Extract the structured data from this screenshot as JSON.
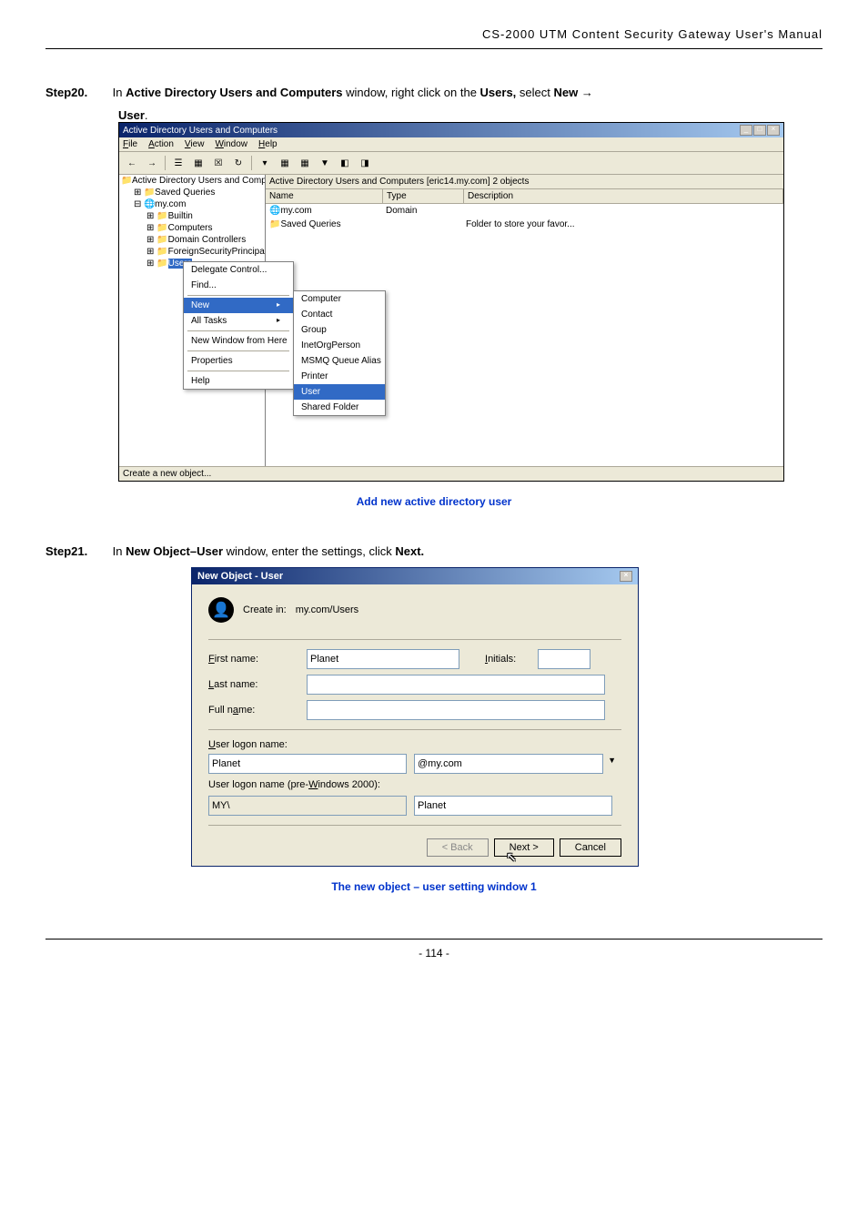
{
  "header": "CS-2000 UTM Content Security Gateway User's Manual",
  "step20": {
    "label": "Step20.",
    "text_parts": [
      "In ",
      "Active Directory Users and Computers",
      " window, right click on the ",
      "Users,",
      " select ",
      "New",
      " →"
    ],
    "text2": "User",
    "text2_suffix": "."
  },
  "aduc": {
    "title": "Active Directory Users and Computers",
    "menu": [
      "File",
      "Action",
      "View",
      "Window",
      "Help"
    ],
    "menu_underline": [
      "F",
      "A",
      "V",
      "W",
      "H"
    ],
    "tree": {
      "root": "Active Directory Users and Comput",
      "nodes": [
        {
          "label": "Saved Queries"
        },
        {
          "label": "my.com",
          "children": [
            {
              "label": "Builtin"
            },
            {
              "label": "Computers"
            },
            {
              "label": "Domain Controllers"
            },
            {
              "label": "ForeignSecurityPrincipals"
            },
            {
              "label": "Users",
              "selected": true
            }
          ]
        }
      ]
    },
    "list": {
      "header_title": "Active Directory Users and Computers [eric14.my.com]   2 objects",
      "columns": [
        "Name",
        "Type",
        "Description"
      ],
      "rows": [
        {
          "name": "my.com",
          "type": "Domain",
          "desc": ""
        },
        {
          "name": "Saved Queries",
          "type": "",
          "desc": "Folder to store your favor..."
        }
      ]
    },
    "context1": [
      "Delegate Control...",
      "Find...",
      "—",
      "New",
      "All Tasks",
      "—",
      "New Window from Here",
      "—",
      "Properties",
      "—",
      "Help"
    ],
    "context1_highlight": "New",
    "context2": [
      "Computer",
      "Contact",
      "Group",
      "InetOrgPerson",
      "MSMQ Queue Alias",
      "Printer",
      "User",
      "Shared Folder"
    ],
    "context2_highlight": "User",
    "status": "Create a new object..."
  },
  "caption1": "Add new active directory user",
  "step21": {
    "label": "Step21.",
    "text_parts": [
      "In ",
      "New Object–User",
      " window, enter the settings, click ",
      "Next."
    ]
  },
  "dialog": {
    "title": "New Object - User",
    "createin_label": "Create in:",
    "createin_value": "my.com/Users",
    "labels": {
      "first": "First name:",
      "last": "Last name:",
      "full": "Full name:",
      "initials": "Initials:",
      "logon": "User logon name:",
      "logon2000": "User logon name (pre-Windows 2000):"
    },
    "values": {
      "first": "Planet",
      "last": "",
      "full": "",
      "initials": "",
      "logon": "Planet",
      "domain": "@my.com",
      "domain2000": "MY\\",
      "logon2000": "Planet"
    },
    "buttons": {
      "back": "< Back",
      "next": "Next >",
      "cancel": "Cancel"
    }
  },
  "caption2": "The new object – user setting window 1",
  "page": "- 114 -"
}
